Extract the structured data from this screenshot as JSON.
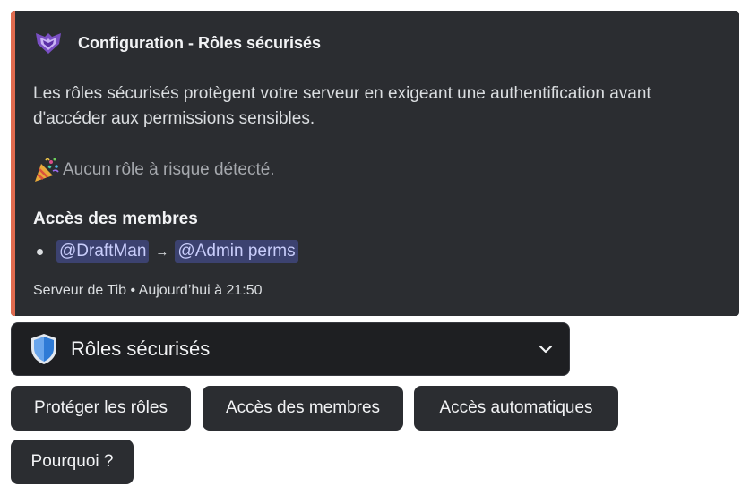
{
  "embed": {
    "accent_color": "#e06b4f",
    "author_icon": "purple-shield-logo-icon",
    "author_name": "Configuration - Rôles sécurisés",
    "description": "Les rôles sécurisés protègent votre serveur en exigeant une authentification avant d'accéder aux permissions sensibles.",
    "status_icon": "party-popper-icon",
    "status_text": "Aucun rôle à risque détecté.",
    "field": {
      "name": "Accès des membres",
      "items": [
        {
          "from": "@DraftMan",
          "arrow": "→",
          "to": "@Admin perms"
        }
      ]
    },
    "footer": "Serveur de Tib • Aujourd’hui à 21:50"
  },
  "select_menu": {
    "icon": "shield-icon",
    "selected_label": "Rôles sécurisés",
    "chevron_icon": "chevron-down-icon"
  },
  "buttons": {
    "protect_label": "Protéger les rôles",
    "access_label": "Accès des membres",
    "auto_label": "Accès automatiques",
    "why_label": "Pourquoi ?"
  },
  "colors": {
    "embed_bg": "#2b2d31",
    "mention_bg": "#3c4270",
    "mention_text": "#c9cdfb",
    "select_bg": "#1e1f22"
  }
}
